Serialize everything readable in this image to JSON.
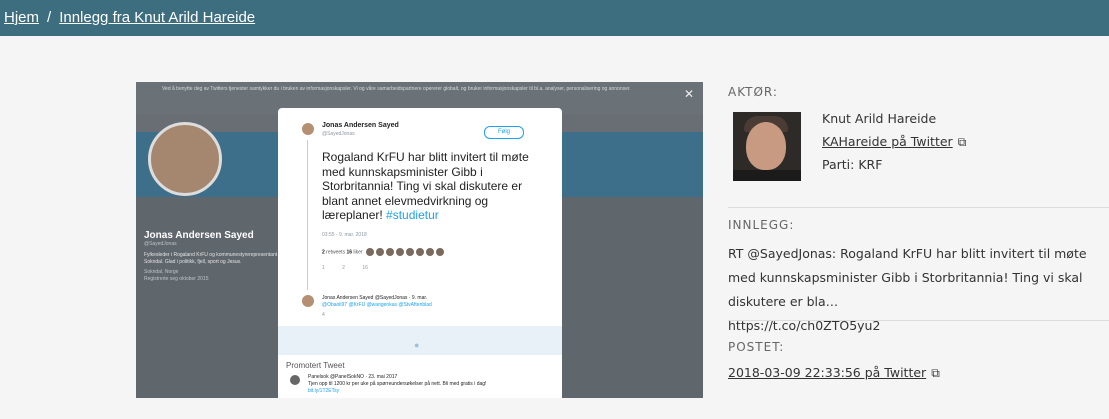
{
  "breadcrumb": {
    "home": "Hjem",
    "separator": "/",
    "current": "Innlegg fra Knut Arild Hareide"
  },
  "colors": {
    "topbar": "#3d6e80",
    "twitter_blue": "#1da1f2"
  },
  "screenshot": {
    "cookie_text": "Ved å benytte deg av Twitters tjenester samtykker du i bruken av informasjonskapsler. Vi og våre samarbeidspartnere opererer globalt, og bruker informasjonskapsler til bl.a. analyser, personalisering og annonser.",
    "close": "✕",
    "profile": {
      "name": "Jonas Andersen Sayed",
      "handle": "@SayedJonas",
      "bio": "Fylkesleder i Rogaland KrFU og kommunestyrerepresentant i Sokndal. Glad i politikk, fjell, sport og Jesus.",
      "location": "Sokndal, Norge",
      "joined": "Registrerte seg oktober 2015"
    },
    "tweet": {
      "author_name": "Jonas Andersen Sayed",
      "author_handle": "@SayedJonas",
      "follow_label": "Følg",
      "text": "Rogaland KrFU har blitt invitert til møte med kunnskapsminister Gibb i Storbritannia! Ting vi skal diskutere er blant annet elevmedvirkning og læreplaner!",
      "hashtag": "#studietur",
      "timestamp": "03:55 - 9. mar. 2018",
      "retweets": "2",
      "retweets_label": "retweets",
      "likes": "16",
      "likes_label": "liker",
      "actions": "1 2 16"
    },
    "reply": {
      "author": "Jonas Andersen Sayed @SayedJonas · 9. mar.",
      "text": "@Obaoli97 @KrFU @wangenkas @StvAftenblad",
      "actions": "4"
    },
    "promoted": {
      "label": "Promotert Tweet",
      "author": "Panelsok @PanelSokNO · 23. mai 2017",
      "text": "Tjen opp til 1200 kr per uke på spørreundersøkelser på nett. Bli med gratis i dag!",
      "link": "bit.ly/1T2ETsy"
    }
  },
  "actor": {
    "label": "AKTØR:",
    "name": "Knut Arild Hareide",
    "twitter_link": "KAHareide på Twitter",
    "party": "Parti: KRF"
  },
  "post": {
    "label": "INNLEGG:",
    "text": "RT @SayedJonas: Rogaland KrFU har blitt invitert til møte med kunnskapsminister Gibb i Storbritannia! Ting vi skal diskutere er bla…",
    "link": "https://t.co/ch0ZTO5yu2"
  },
  "posted": {
    "label": "POSTET:",
    "link": "2018-03-09 22:33:56 på Twitter"
  },
  "icons": {
    "external_link": "⧉"
  }
}
